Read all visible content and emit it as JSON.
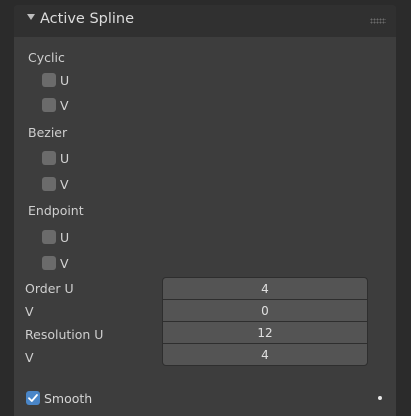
{
  "panel": {
    "title": "Active Spline"
  },
  "cyclic": {
    "label": "Cyclic",
    "u": {
      "label": "U",
      "checked": false
    },
    "v": {
      "label": "V",
      "checked": false
    }
  },
  "bezier": {
    "label": "Bezier",
    "u": {
      "label": "U",
      "checked": false
    },
    "v": {
      "label": "V",
      "checked": false
    }
  },
  "endpoint": {
    "label": "Endpoint",
    "u": {
      "label": "U",
      "checked": false
    },
    "v": {
      "label": "V",
      "checked": false
    }
  },
  "order": {
    "u_label": "Order U",
    "u_value": "4",
    "v_label": "V",
    "v_value": "0"
  },
  "resolution": {
    "u_label": "Resolution U",
    "u_value": "12",
    "v_label": "V",
    "v_value": "4"
  },
  "smooth": {
    "label": "Smooth",
    "checked": true
  },
  "colors": {
    "panel_bg": "#3d3d3d",
    "header_bg": "#303030",
    "field_bg": "#545454",
    "checkbox_off": "#6b6b6b",
    "checkbox_on": "#4a86c8"
  }
}
